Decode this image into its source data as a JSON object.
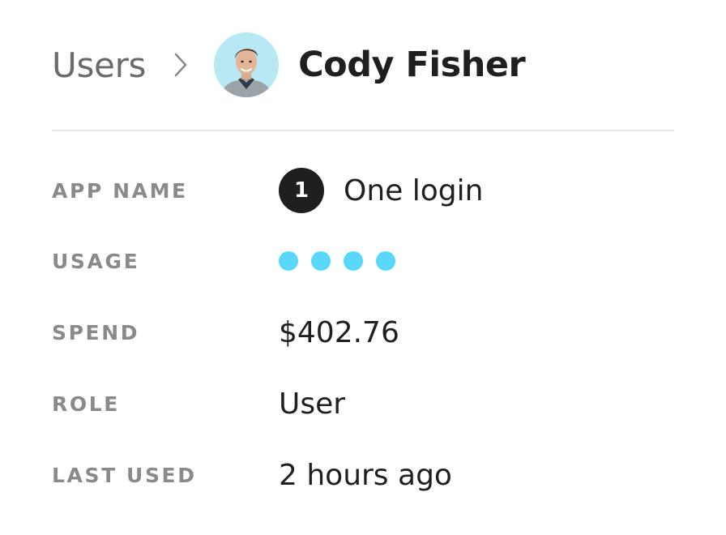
{
  "breadcrumb": {
    "parent_label": "Users",
    "user_name": "Cody Fisher",
    "avatar_bg": "#b9e8f5"
  },
  "details": {
    "app_name": {
      "label": "APP NAME",
      "badge": "1",
      "value": "One login"
    },
    "usage": {
      "label": "USAGE",
      "level": 4,
      "dot_color": "#5ad8fb"
    },
    "spend": {
      "label": "SPEND",
      "value": "$402.76"
    },
    "role": {
      "label": "ROLE",
      "value": "User"
    },
    "last_used": {
      "label": "LAST USED",
      "value": "2 hours ago"
    }
  }
}
